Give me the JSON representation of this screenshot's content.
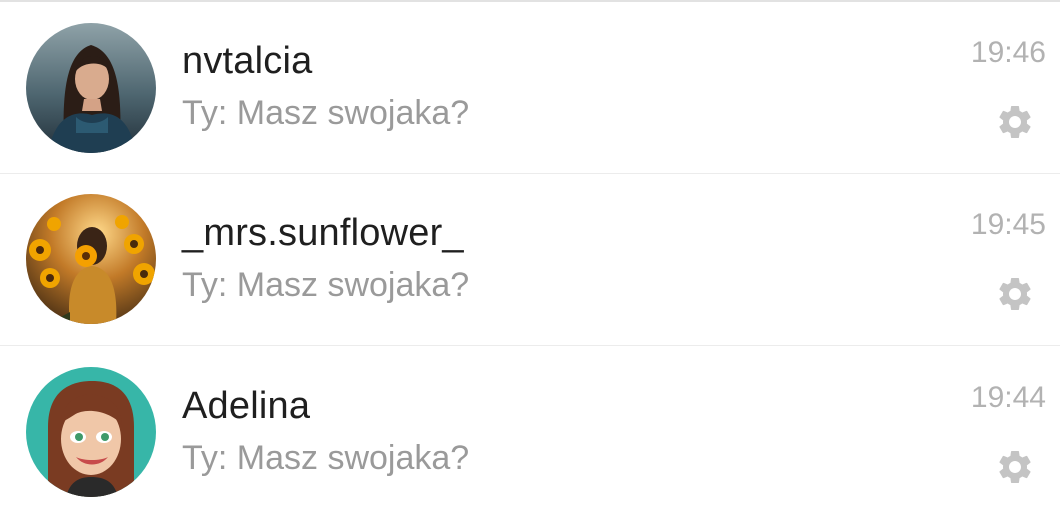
{
  "conversations": [
    {
      "name": "nvtalcia",
      "preview": "Ty: Masz swojaka?",
      "time": "19:46",
      "avatar": "photo-dark-haired-woman",
      "action_icon": "gear-icon"
    },
    {
      "name": "_mrs.sunflower_",
      "preview": "Ty: Masz swojaka?",
      "time": "19:45",
      "avatar": "photo-sunflower-field",
      "action_icon": "gear-icon"
    },
    {
      "name": "Adelina",
      "preview": "Ty: Masz swojaka?",
      "time": "19:44",
      "avatar": "bitmoji-cartoon-woman",
      "action_icon": "gear-icon"
    }
  ],
  "colors": {
    "name_text": "#1f1f1f",
    "preview_text": "#9a9a9a",
    "time_text": "#b2b2b2",
    "gear_icon": "#c4c4c4",
    "divider": "#ececec",
    "avatar_bitmoji_bg": "#37b6a8"
  }
}
